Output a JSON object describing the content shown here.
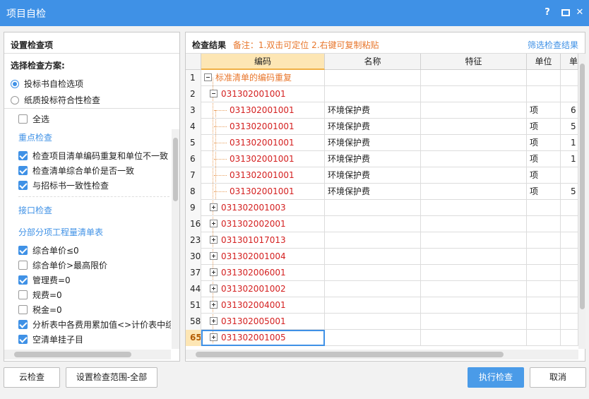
{
  "window": {
    "title": "项目自检",
    "help_label": "?",
    "close_label": "✕"
  },
  "left": {
    "header": "设置检查项",
    "scheme_label": "选择检查方案:",
    "schemes": [
      {
        "label": "投标书自检选项",
        "selected": true
      },
      {
        "label": "纸质投标符合性检查",
        "selected": false
      }
    ],
    "select_all": "全选",
    "sections": {
      "key": "重点检查",
      "interface": "接口检查",
      "boq": "分部分项工程量清单表"
    },
    "key_items": [
      {
        "label": "检查项目清单编码重复和单位不一致",
        "checked": true
      },
      {
        "label": "检查清单综合单价是否一致",
        "checked": true
      },
      {
        "label": "与招标书一致性检查",
        "checked": true
      }
    ],
    "boq_items": [
      {
        "label": "综合单价≤0",
        "checked": true
      },
      {
        "label": "综合单价>最高限价",
        "checked": false
      },
      {
        "label": "管理费=0",
        "checked": true
      },
      {
        "label": "规费=0",
        "checked": false
      },
      {
        "label": "税金=0",
        "checked": false
      },
      {
        "label": "分析表中各费用累加值<>计价表中综合单价",
        "checked": true
      },
      {
        "label": "空清单挂子目",
        "checked": true
      }
    ]
  },
  "right": {
    "title": "检查结果",
    "note": "备注：1.双击可定位 2.右键可复制粘贴",
    "filter_link": "筛选检查结果",
    "columns": [
      "编码",
      "名称",
      "特征",
      "单位",
      "单"
    ],
    "rows": [
      {
        "num": "1",
        "code": "标准清单的编码重复",
        "name": "",
        "unit": "",
        "extra": "",
        "kind": "root"
      },
      {
        "num": "2",
        "code": "031302001001",
        "name": "",
        "unit": "",
        "extra": "",
        "kind": "group-open"
      },
      {
        "num": "3",
        "code": "031302001001",
        "name": "环境保护费",
        "unit": "项",
        "extra": "6",
        "kind": "child"
      },
      {
        "num": "4",
        "code": "031302001001",
        "name": "环境保护费",
        "unit": "项",
        "extra": "5",
        "kind": "child"
      },
      {
        "num": "5",
        "code": "031302001001",
        "name": "环境保护费",
        "unit": "项",
        "extra": "1",
        "kind": "child"
      },
      {
        "num": "6",
        "code": "031302001001",
        "name": "环境保护费",
        "unit": "项",
        "extra": "1",
        "kind": "child"
      },
      {
        "num": "7",
        "code": "031302001001",
        "name": "环境保护费",
        "unit": "项",
        "extra": "",
        "kind": "child"
      },
      {
        "num": "8",
        "code": "031302001001",
        "name": "环境保护费",
        "unit": "项",
        "extra": "5",
        "kind": "child-last"
      },
      {
        "num": "9",
        "code": "031302001003",
        "name": "",
        "unit": "",
        "extra": "",
        "kind": "group"
      },
      {
        "num": "16",
        "code": "031302002001",
        "name": "",
        "unit": "",
        "extra": "",
        "kind": "group"
      },
      {
        "num": "23",
        "code": "031301017013",
        "name": "",
        "unit": "",
        "extra": "",
        "kind": "group"
      },
      {
        "num": "30",
        "code": "031302001004",
        "name": "",
        "unit": "",
        "extra": "",
        "kind": "group"
      },
      {
        "num": "37",
        "code": "031302006001",
        "name": "",
        "unit": "",
        "extra": "",
        "kind": "group"
      },
      {
        "num": "44",
        "code": "031302001002",
        "name": "",
        "unit": "",
        "extra": "",
        "kind": "group"
      },
      {
        "num": "51",
        "code": "031302004001",
        "name": "",
        "unit": "",
        "extra": "",
        "kind": "group"
      },
      {
        "num": "58",
        "code": "031302005001",
        "name": "",
        "unit": "",
        "extra": "",
        "kind": "group"
      },
      {
        "num": "65",
        "code": "031302001005",
        "name": "",
        "unit": "",
        "extra": "",
        "kind": "group",
        "selected": true
      }
    ]
  },
  "buttons": {
    "cloud": "云检查",
    "range": "设置检查范围-全部",
    "run": "执行检查",
    "cancel": "取消"
  },
  "colors": {
    "accent": "#3f91e6",
    "error_code": "#d42020",
    "note": "#e8762b"
  }
}
